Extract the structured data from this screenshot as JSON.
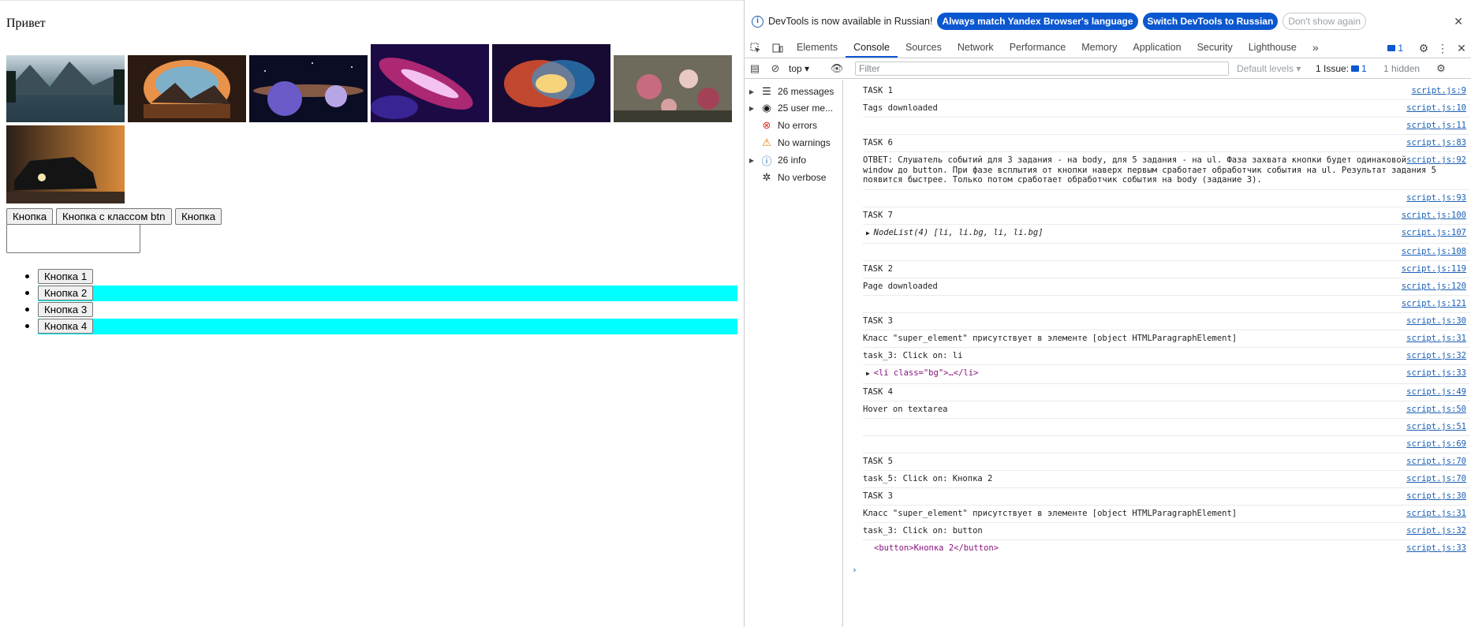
{
  "page": {
    "title": "Привет",
    "buttons": [
      "Кнопка",
      "Кнопка с классом btn",
      "Кнопка"
    ],
    "list_buttons": [
      "Кнопка 1",
      "Кнопка 2",
      "Кнопка 3",
      "Кнопка 4"
    ]
  },
  "devtools": {
    "infobar": {
      "text": "DevTools is now available in Russian!",
      "btn_match": "Always match Yandex Browser's language",
      "btn_switch": "Switch DevTools to Russian",
      "btn_dismiss": "Don't show again"
    },
    "tabs": [
      "Elements",
      "Console",
      "Sources",
      "Network",
      "Performance",
      "Memory",
      "Application",
      "Security",
      "Lighthouse"
    ],
    "active_tab": "Console",
    "message_badge": "1",
    "toolbar": {
      "context": "top",
      "filter_placeholder": "Filter",
      "levels": "Default levels",
      "issues_label": "1 Issue:",
      "issues_count": "1",
      "hidden": "1 hidden"
    },
    "sidebar": [
      {
        "label": "26 messages",
        "icon": "list-icon"
      },
      {
        "label": "25 user me...",
        "icon": "user-icon"
      },
      {
        "label": "No errors",
        "icon": "error-icon"
      },
      {
        "label": "No warnings",
        "icon": "warning-icon"
      },
      {
        "label": "26 info",
        "icon": "info-icon"
      },
      {
        "label": "No verbose",
        "icon": "bug-icon"
      }
    ],
    "console": [
      {
        "msg": "TASK 1",
        "src": "script.js:9"
      },
      {
        "msg": "Tags downloaded",
        "src": "script.js:10"
      },
      {
        "msg": "",
        "src": "script.js:11"
      },
      {
        "msg": "TASK 6",
        "src": "script.js:83"
      },
      {
        "msg": "ОТВЕТ: Слушатель событий для 3 задания - на body, для 5 задания - на ul. Фаза захвата кнопки будет одинаковой от window до button. При фазе всплытия от кнопки наверх первым сработает обработчик события на ul. Результат задания 5 появится быстрее. Только потом сработает обработчик события на body (задание 3).",
        "src": "script.js:92"
      },
      {
        "msg": "",
        "src": "script.js:93"
      },
      {
        "msg": "TASK 7",
        "src": "script.js:100"
      },
      {
        "msg": "NodeList(4) [li, li.bg, li, li.bg]",
        "src": "script.js:107"
      },
      {
        "msg": "",
        "src": "script.js:108"
      },
      {
        "msg": "TASK 2",
        "src": "script.js:119"
      },
      {
        "msg": "Page downloaded",
        "src": "script.js:120"
      },
      {
        "msg": "",
        "src": "script.js:121"
      },
      {
        "msg": "TASK 3",
        "src": "script.js:30"
      },
      {
        "msg": "Класс \"super_element\" присутствует в элементе [object HTMLParagraphElement]",
        "src": "script.js:31"
      },
      {
        "msg": "task_3: Click on: li",
        "src": "script.js:32"
      },
      {
        "msg": "<li class=\"bg\">…</li>",
        "src": "script.js:33"
      },
      {
        "msg": "TASK 4",
        "src": "script.js:49"
      },
      {
        "msg": "Hover on textarea",
        "src": "script.js:50"
      },
      {
        "msg": "",
        "src": "script.js:51"
      },
      {
        "msg": "",
        "src": "script.js:69"
      },
      {
        "msg": "TASK 5",
        "src": "script.js:70"
      },
      {
        "msg": "task_5: Click on: Кнопка 2",
        "src": "script.js:70"
      },
      {
        "msg": "TASK 3",
        "src": "script.js:30"
      },
      {
        "msg": "Класс \"super_element\" присутствует в элементе [object HTMLParagraphElement]",
        "src": "script.js:31"
      },
      {
        "msg": "task_3: Click on: button",
        "src": "script.js:32"
      },
      {
        "msg": "<button>Кнопка 2</button>",
        "src": "script.js:33"
      }
    ]
  }
}
